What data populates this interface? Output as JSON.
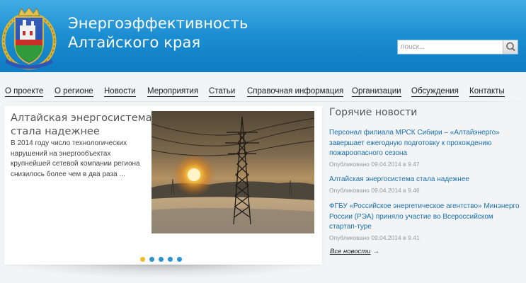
{
  "header": {
    "title_line1": "Энергоэффективность",
    "title_line2": "Алтайского края",
    "logo_icon": "altai-krai-coat-of-arms-icon"
  },
  "search": {
    "placeholder": "поиск...",
    "button_icon": "magnifier-icon"
  },
  "nav": {
    "items": [
      {
        "label": "О проекте"
      },
      {
        "label": "О регионе"
      },
      {
        "label": "Новости"
      },
      {
        "label": "Мероприятия"
      },
      {
        "label": "Статьи"
      },
      {
        "label": "Справочная информация"
      },
      {
        "label": "Организации"
      },
      {
        "label": "Обсуждения"
      },
      {
        "label": "Контакты"
      }
    ]
  },
  "slider": {
    "title": "Алтайская энергосистема стала надежнее",
    "text": "В 2014 году число технологических нарушений на энергообъектах крупнейшей сетевой компании региона снизилось более чем в два раза ...",
    "photo": "power-line-at-sunset",
    "dots_count": 5,
    "active_dot": 1
  },
  "hot_news": {
    "title": "Горячие новости",
    "items": [
      {
        "headline": "Персонал филиала МРСК Сибири – «Алтайэнерго» завершает ежегодную подготовку к прохождению пожароопасного сезона",
        "date": "Опубликовано 09.04.2014 в 9.47"
      },
      {
        "headline": "Алтайская энергосистема стала надежнее",
        "date": "Опубликовано 09.04.2014 в 9.46"
      },
      {
        "headline": "ФГБУ «Российское энергетическое агентство» Минэнерго России (РЭА) приняло участие во Всероссийском стартап-туре",
        "date": "Опубликовано 09.04.2014 в 9.41"
      }
    ],
    "all_news_label": "Все новости",
    "all_news_arrow": "→"
  },
  "colors": {
    "header_blue": "#1c8fd2",
    "link_blue": "#1a6fb0",
    "dot_active": "#f2b928",
    "dot_inactive": "#2a93d0"
  }
}
